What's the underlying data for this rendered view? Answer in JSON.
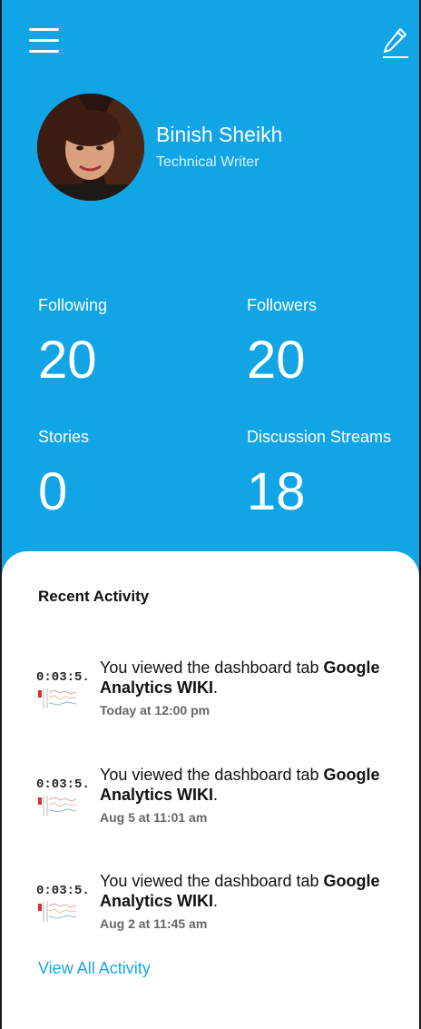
{
  "profile": {
    "name": "Binish Sheikh",
    "role": "Technical Writer"
  },
  "stats": {
    "following_label": "Following",
    "following_value": "20",
    "followers_label": "Followers",
    "followers_value": "20",
    "stories_label": "Stories",
    "stories_value": "0",
    "streams_label": "Discussion Streams",
    "streams_value": "18"
  },
  "recent": {
    "title": "Recent Activity",
    "items": [
      {
        "thumb": "0:03:5.",
        "prefix": "You viewed the dashboard tab ",
        "strong_1": "Google",
        "strong_2": "Analytics WIKI",
        "suffix": ".",
        "time": "Today at 12:00 pm"
      },
      {
        "thumb": "0:03:5.",
        "prefix": "You viewed the dashboard tab ",
        "strong_1": "Google",
        "strong_2": "Analytics WIKI",
        "suffix": ".",
        "time": "Aug 5 at 11:01 am"
      },
      {
        "thumb": "0:03:5.",
        "prefix": "You viewed the dashboard tab ",
        "strong_1": "Google",
        "strong_2": "Analytics WIKI",
        "suffix": ".",
        "time": "Aug 2 at 11:45 am"
      }
    ],
    "view_all": "View All Activity"
  },
  "colors": {
    "header_bg": "#12a5e6",
    "link": "#14a6e6"
  },
  "icons": {
    "menu": "hamburger-menu-icon",
    "edit": "pencil-icon"
  }
}
